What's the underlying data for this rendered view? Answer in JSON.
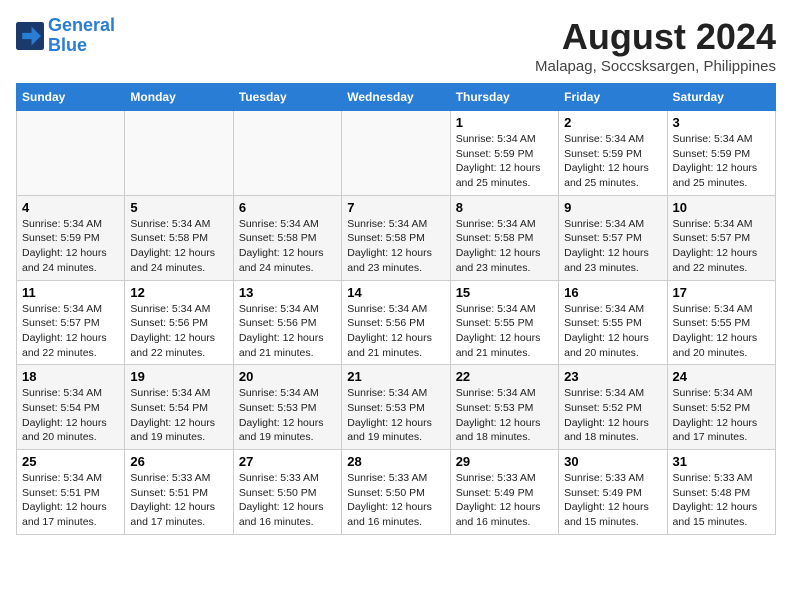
{
  "header": {
    "logo_line1": "General",
    "logo_line2": "Blue",
    "month_title": "August 2024",
    "location": "Malapag, Soccsksargen, Philippines"
  },
  "days_of_week": [
    "Sunday",
    "Monday",
    "Tuesday",
    "Wednesday",
    "Thursday",
    "Friday",
    "Saturday"
  ],
  "weeks": [
    [
      {
        "day": "",
        "text": ""
      },
      {
        "day": "",
        "text": ""
      },
      {
        "day": "",
        "text": ""
      },
      {
        "day": "",
        "text": ""
      },
      {
        "day": "1",
        "text": "Sunrise: 5:34 AM\nSunset: 5:59 PM\nDaylight: 12 hours\nand 25 minutes."
      },
      {
        "day": "2",
        "text": "Sunrise: 5:34 AM\nSunset: 5:59 PM\nDaylight: 12 hours\nand 25 minutes."
      },
      {
        "day": "3",
        "text": "Sunrise: 5:34 AM\nSunset: 5:59 PM\nDaylight: 12 hours\nand 25 minutes."
      }
    ],
    [
      {
        "day": "4",
        "text": "Sunrise: 5:34 AM\nSunset: 5:59 PM\nDaylight: 12 hours\nand 24 minutes."
      },
      {
        "day": "5",
        "text": "Sunrise: 5:34 AM\nSunset: 5:58 PM\nDaylight: 12 hours\nand 24 minutes."
      },
      {
        "day": "6",
        "text": "Sunrise: 5:34 AM\nSunset: 5:58 PM\nDaylight: 12 hours\nand 24 minutes."
      },
      {
        "day": "7",
        "text": "Sunrise: 5:34 AM\nSunset: 5:58 PM\nDaylight: 12 hours\nand 23 minutes."
      },
      {
        "day": "8",
        "text": "Sunrise: 5:34 AM\nSunset: 5:58 PM\nDaylight: 12 hours\nand 23 minutes."
      },
      {
        "day": "9",
        "text": "Sunrise: 5:34 AM\nSunset: 5:57 PM\nDaylight: 12 hours\nand 23 minutes."
      },
      {
        "day": "10",
        "text": "Sunrise: 5:34 AM\nSunset: 5:57 PM\nDaylight: 12 hours\nand 22 minutes."
      }
    ],
    [
      {
        "day": "11",
        "text": "Sunrise: 5:34 AM\nSunset: 5:57 PM\nDaylight: 12 hours\nand 22 minutes."
      },
      {
        "day": "12",
        "text": "Sunrise: 5:34 AM\nSunset: 5:56 PM\nDaylight: 12 hours\nand 22 minutes."
      },
      {
        "day": "13",
        "text": "Sunrise: 5:34 AM\nSunset: 5:56 PM\nDaylight: 12 hours\nand 21 minutes."
      },
      {
        "day": "14",
        "text": "Sunrise: 5:34 AM\nSunset: 5:56 PM\nDaylight: 12 hours\nand 21 minutes."
      },
      {
        "day": "15",
        "text": "Sunrise: 5:34 AM\nSunset: 5:55 PM\nDaylight: 12 hours\nand 21 minutes."
      },
      {
        "day": "16",
        "text": "Sunrise: 5:34 AM\nSunset: 5:55 PM\nDaylight: 12 hours\nand 20 minutes."
      },
      {
        "day": "17",
        "text": "Sunrise: 5:34 AM\nSunset: 5:55 PM\nDaylight: 12 hours\nand 20 minutes."
      }
    ],
    [
      {
        "day": "18",
        "text": "Sunrise: 5:34 AM\nSunset: 5:54 PM\nDaylight: 12 hours\nand 20 minutes."
      },
      {
        "day": "19",
        "text": "Sunrise: 5:34 AM\nSunset: 5:54 PM\nDaylight: 12 hours\nand 19 minutes."
      },
      {
        "day": "20",
        "text": "Sunrise: 5:34 AM\nSunset: 5:53 PM\nDaylight: 12 hours\nand 19 minutes."
      },
      {
        "day": "21",
        "text": "Sunrise: 5:34 AM\nSunset: 5:53 PM\nDaylight: 12 hours\nand 19 minutes."
      },
      {
        "day": "22",
        "text": "Sunrise: 5:34 AM\nSunset: 5:53 PM\nDaylight: 12 hours\nand 18 minutes."
      },
      {
        "day": "23",
        "text": "Sunrise: 5:34 AM\nSunset: 5:52 PM\nDaylight: 12 hours\nand 18 minutes."
      },
      {
        "day": "24",
        "text": "Sunrise: 5:34 AM\nSunset: 5:52 PM\nDaylight: 12 hours\nand 17 minutes."
      }
    ],
    [
      {
        "day": "25",
        "text": "Sunrise: 5:34 AM\nSunset: 5:51 PM\nDaylight: 12 hours\nand 17 minutes."
      },
      {
        "day": "26",
        "text": "Sunrise: 5:33 AM\nSunset: 5:51 PM\nDaylight: 12 hours\nand 17 minutes."
      },
      {
        "day": "27",
        "text": "Sunrise: 5:33 AM\nSunset: 5:50 PM\nDaylight: 12 hours\nand 16 minutes."
      },
      {
        "day": "28",
        "text": "Sunrise: 5:33 AM\nSunset: 5:50 PM\nDaylight: 12 hours\nand 16 minutes."
      },
      {
        "day": "29",
        "text": "Sunrise: 5:33 AM\nSunset: 5:49 PM\nDaylight: 12 hours\nand 16 minutes."
      },
      {
        "day": "30",
        "text": "Sunrise: 5:33 AM\nSunset: 5:49 PM\nDaylight: 12 hours\nand 15 minutes."
      },
      {
        "day": "31",
        "text": "Sunrise: 5:33 AM\nSunset: 5:48 PM\nDaylight: 12 hours\nand 15 minutes."
      }
    ]
  ]
}
